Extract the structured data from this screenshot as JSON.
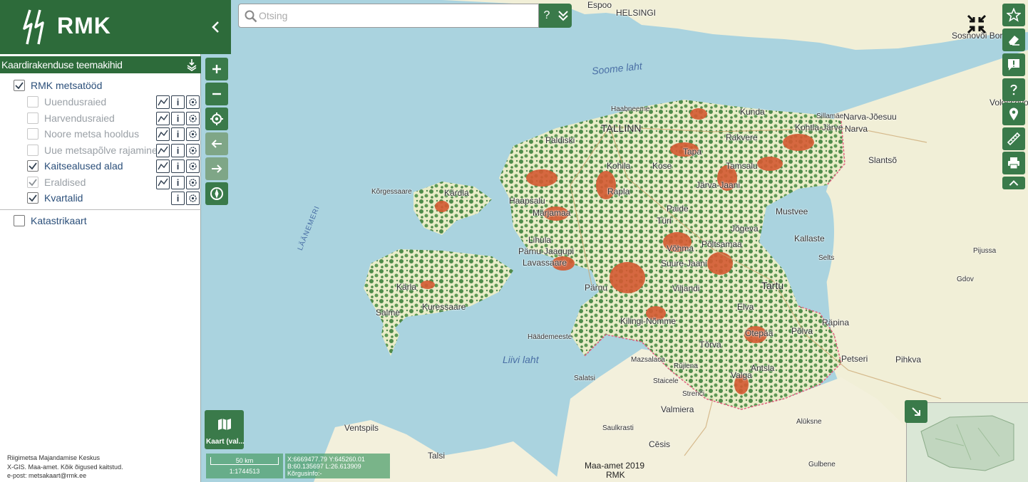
{
  "sidebar": {
    "logo_text": "RMK",
    "section_title": "Kaardirakenduse teemakihid",
    "groups": [
      {
        "label": "RMK metsatööd",
        "checked": true
      },
      {
        "label": "Katastrikaart",
        "checked": false
      }
    ],
    "layers": [
      {
        "label": "Uuendusraied",
        "checked": false,
        "enabled": false
      },
      {
        "label": "Harvendusraied",
        "checked": false,
        "enabled": false
      },
      {
        "label": "Noore metsa hooldus",
        "checked": false,
        "enabled": false
      },
      {
        "label": "Uue metsapõlve rajamine",
        "checked": false,
        "enabled": false
      },
      {
        "label": "Kaitsealused alad",
        "checked": true,
        "enabled": true
      },
      {
        "label": "Eraldised",
        "checked": true,
        "enabled": false
      },
      {
        "label": "Kvartalid",
        "checked": true,
        "enabled": true
      }
    ],
    "info_glyph": "i",
    "footer": {
      "line1": "Riigimetsa Majandamise Keskus",
      "line2": "X-GIS. Maa-amet. Kõik õigused kaitstud.",
      "line3": "e-post: metsakaart@rmk.ee"
    }
  },
  "search": {
    "placeholder": "Otsing",
    "help_label": "?"
  },
  "basemap": {
    "label": "Kaart (val..."
  },
  "scale": {
    "distance": "50 km",
    "ratio": "1:1744513"
  },
  "coordinates": {
    "xy": "X:6669477.79 Y:645260.01",
    "bl": "B:60.135697 L:26.613909",
    "elevation": "Kõrgusinfo:-"
  },
  "attribution": {
    "line1": "Maa-amet 2019",
    "line2": "RMK"
  },
  "map": {
    "places": [
      {
        "name": "Espoo",
        "cls": "place"
      },
      {
        "name": "HELSINGI",
        "cls": "place"
      },
      {
        "name": "Sosnovõi Bor",
        "cls": "place"
      },
      {
        "name": "Soome laht",
        "cls": "place water"
      },
      {
        "name": "Haabneeme",
        "cls": "place"
      },
      {
        "name": "TALLINN",
        "cls": "place big"
      },
      {
        "name": "Paldiski",
        "cls": "place"
      },
      {
        "name": "Kunda",
        "cls": "place"
      },
      {
        "name": "Rakvere",
        "cls": "place"
      },
      {
        "name": "Kohtla-Järve",
        "cls": "place"
      },
      {
        "name": "Sillamäe",
        "cls": "place"
      },
      {
        "name": "Narva-Jõesuu",
        "cls": "place"
      },
      {
        "name": "Narva",
        "cls": "place"
      },
      {
        "name": "Volossovo",
        "cls": "place"
      },
      {
        "name": "Slantsõ",
        "cls": "place"
      },
      {
        "name": "Tapa",
        "cls": "place"
      },
      {
        "name": "Tamsalu",
        "cls": "place"
      },
      {
        "name": "Kohila",
        "cls": "place"
      },
      {
        "name": "Kose",
        "cls": "place"
      },
      {
        "name": "Rapla",
        "cls": "place"
      },
      {
        "name": "Järva-Jaani",
        "cls": "place"
      },
      {
        "name": "Kärdla",
        "cls": "place"
      },
      {
        "name": "Kõrgessaare",
        "cls": "place"
      },
      {
        "name": "Haapsalu",
        "cls": "place"
      },
      {
        "name": "Märjamaa",
        "cls": "place"
      },
      {
        "name": "Türi",
        "cls": "place"
      },
      {
        "name": "Paide",
        "cls": "place"
      },
      {
        "name": "Mustvee",
        "cls": "place"
      },
      {
        "name": "Kallaste",
        "cls": "place"
      },
      {
        "name": "Jõgeva",
        "cls": "place"
      },
      {
        "name": "Põltsamaa",
        "cls": "place"
      },
      {
        "name": "Lihula",
        "cls": "place"
      },
      {
        "name": "Pärnu-Jaagupi",
        "cls": "place"
      },
      {
        "name": "Lavassaare",
        "cls": "place"
      },
      {
        "name": "Võhma",
        "cls": "place"
      },
      {
        "name": "Suure-Jaani",
        "cls": "place"
      },
      {
        "name": "Pärnu",
        "cls": "place"
      },
      {
        "name": "Viljandi",
        "cls": "place"
      },
      {
        "name": "Tartu",
        "cls": "place big"
      },
      {
        "name": "Kärla",
        "cls": "place"
      },
      {
        "name": "Kuressaare",
        "cls": "place"
      },
      {
        "name": "Salme",
        "cls": "place"
      },
      {
        "name": "Pijussa",
        "cls": "place"
      },
      {
        "name": "Gdov",
        "cls": "place"
      },
      {
        "name": "Selts",
        "cls": "place"
      },
      {
        "name": "Elva",
        "cls": "place"
      },
      {
        "name": "Kilingi-Nõmme",
        "cls": "place"
      },
      {
        "name": "Häädemeeste",
        "cls": "place"
      },
      {
        "name": "Otepää",
        "cls": "place"
      },
      {
        "name": "Põlva",
        "cls": "place"
      },
      {
        "name": "Räpina",
        "cls": "place"
      },
      {
        "name": "Tõrva",
        "cls": "place"
      },
      {
        "name": "Liivi laht",
        "cls": "place water"
      },
      {
        "name": "Mazsalaca",
        "cls": "place"
      },
      {
        "name": "Rūjiena",
        "cls": "place"
      },
      {
        "name": "Valga",
        "cls": "place"
      },
      {
        "name": "Antsla",
        "cls": "place"
      },
      {
        "name": "Petseri",
        "cls": "place"
      },
      {
        "name": "Pihkva",
        "cls": "place"
      },
      {
        "name": "Salatsi",
        "cls": "place"
      },
      {
        "name": "Staicele",
        "cls": "place"
      },
      {
        "name": "Strenči",
        "cls": "place"
      },
      {
        "name": "Valmiera",
        "cls": "place"
      },
      {
        "name": "Alūksne",
        "cls": "place"
      },
      {
        "name": "Ventspils",
        "cls": "place"
      },
      {
        "name": "Talsi",
        "cls": "place"
      },
      {
        "name": "Saulkrasti",
        "cls": "place"
      },
      {
        "name": "Cēsis",
        "cls": "place"
      },
      {
        "name": "Gulbene",
        "cls": "place"
      },
      {
        "name": "LÄÄNEMERI",
        "cls": "place water-sm"
      }
    ]
  },
  "colors": {
    "brand_green": "#2d6b3a",
    "control_green": "#3a7a4a",
    "sea": "#aad3df",
    "forest": "#4f8b4a",
    "protected": "#d45a32",
    "land": "#f2efd5"
  }
}
